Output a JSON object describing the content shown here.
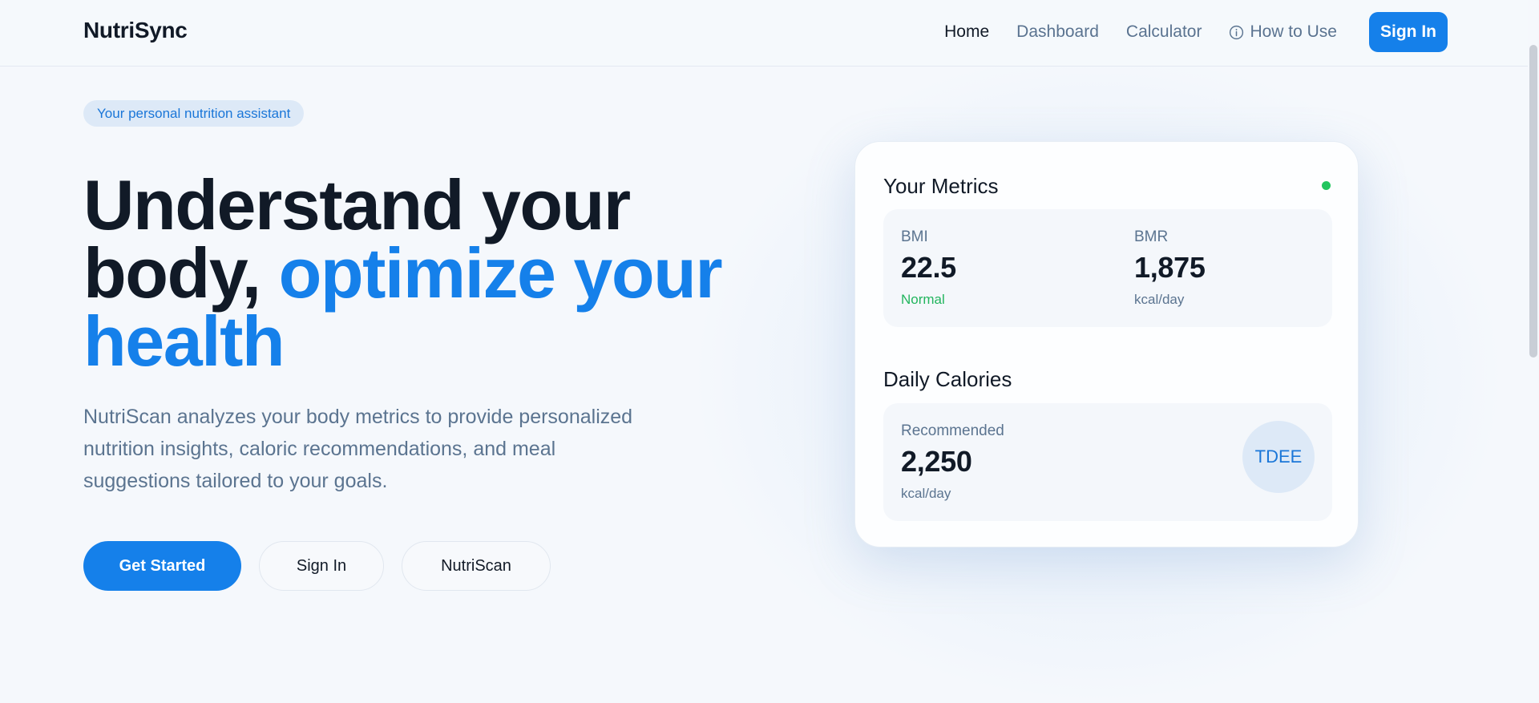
{
  "brand": {
    "name": "NutriSync"
  },
  "nav": {
    "items": [
      {
        "label": "Home",
        "active": true
      },
      {
        "label": "Dashboard"
      },
      {
        "label": "Calculator"
      },
      {
        "label": "How to Use",
        "icon": "info-icon"
      }
    ],
    "sign_in": "Sign In"
  },
  "hero": {
    "badge": "Your personal nutrition assistant",
    "headline_part1": "Understand your body, ",
    "headline_accent": "optimize your health",
    "subtext": "NutriScan analyzes your body metrics to provide personalized nutrition insights, caloric recommendations, and meal suggestions tailored to your goals.",
    "buttons": {
      "get_started": "Get Started",
      "sign_in": "Sign In",
      "nutriscan": "NutriScan"
    }
  },
  "metrics_card": {
    "title": "Your Metrics",
    "status_color": "#22c55e",
    "bmi": {
      "label": "BMI",
      "value": "22.5",
      "note": "Normal"
    },
    "bmr": {
      "label": "BMR",
      "value": "1,875",
      "note": "kcal/day"
    },
    "daily_title": "Daily Calories",
    "recommended": {
      "label": "Recommended",
      "value": "2,250",
      "note": "kcal/day"
    },
    "tdee_badge": "TDEE"
  },
  "colors": {
    "accent": "#1580ea",
    "success": "#22c55e",
    "text_dark": "#111a27",
    "text_muted": "#5b7490"
  }
}
